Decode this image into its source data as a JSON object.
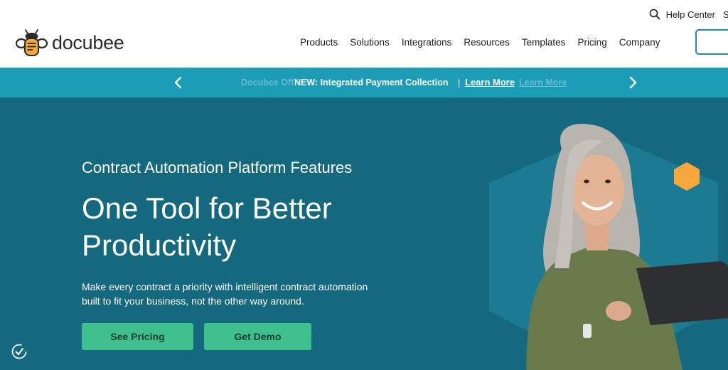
{
  "utility": {
    "help_center": "Help Center",
    "cut_item": "S"
  },
  "brand": {
    "name": "docubee",
    "accent": "#1d9cb8",
    "bee_yellow": "#f2a93b"
  },
  "nav": {
    "items": [
      "Products",
      "Solutions",
      "Integrations",
      "Resources",
      "Templates",
      "Pricing",
      "Company"
    ]
  },
  "announcement": {
    "message": "NEW: Integrated Payment Collection",
    "separator": "|",
    "link": "Learn More",
    "ghost_text": "Docubee Off",
    "ghost_link": "Learn More",
    "prev_icon": "chevron-left-icon",
    "next_icon": "chevron-right-icon"
  },
  "hero": {
    "eyebrow": "Contract Automation Platform Features",
    "headline_line1": "One Tool for Better",
    "headline_line2": "Productivity",
    "subtext": "Make every contract a priority with intelligent contract automation built to fit your business, not the other way around.",
    "primary_button": "See Pricing",
    "secondary_button": "Get Demo",
    "background": "#15697f",
    "button_color": "#3ec08e"
  },
  "icons": {
    "search": "search-icon",
    "accessibility": "accessibility-icon",
    "logo": "bee-logo-icon"
  }
}
